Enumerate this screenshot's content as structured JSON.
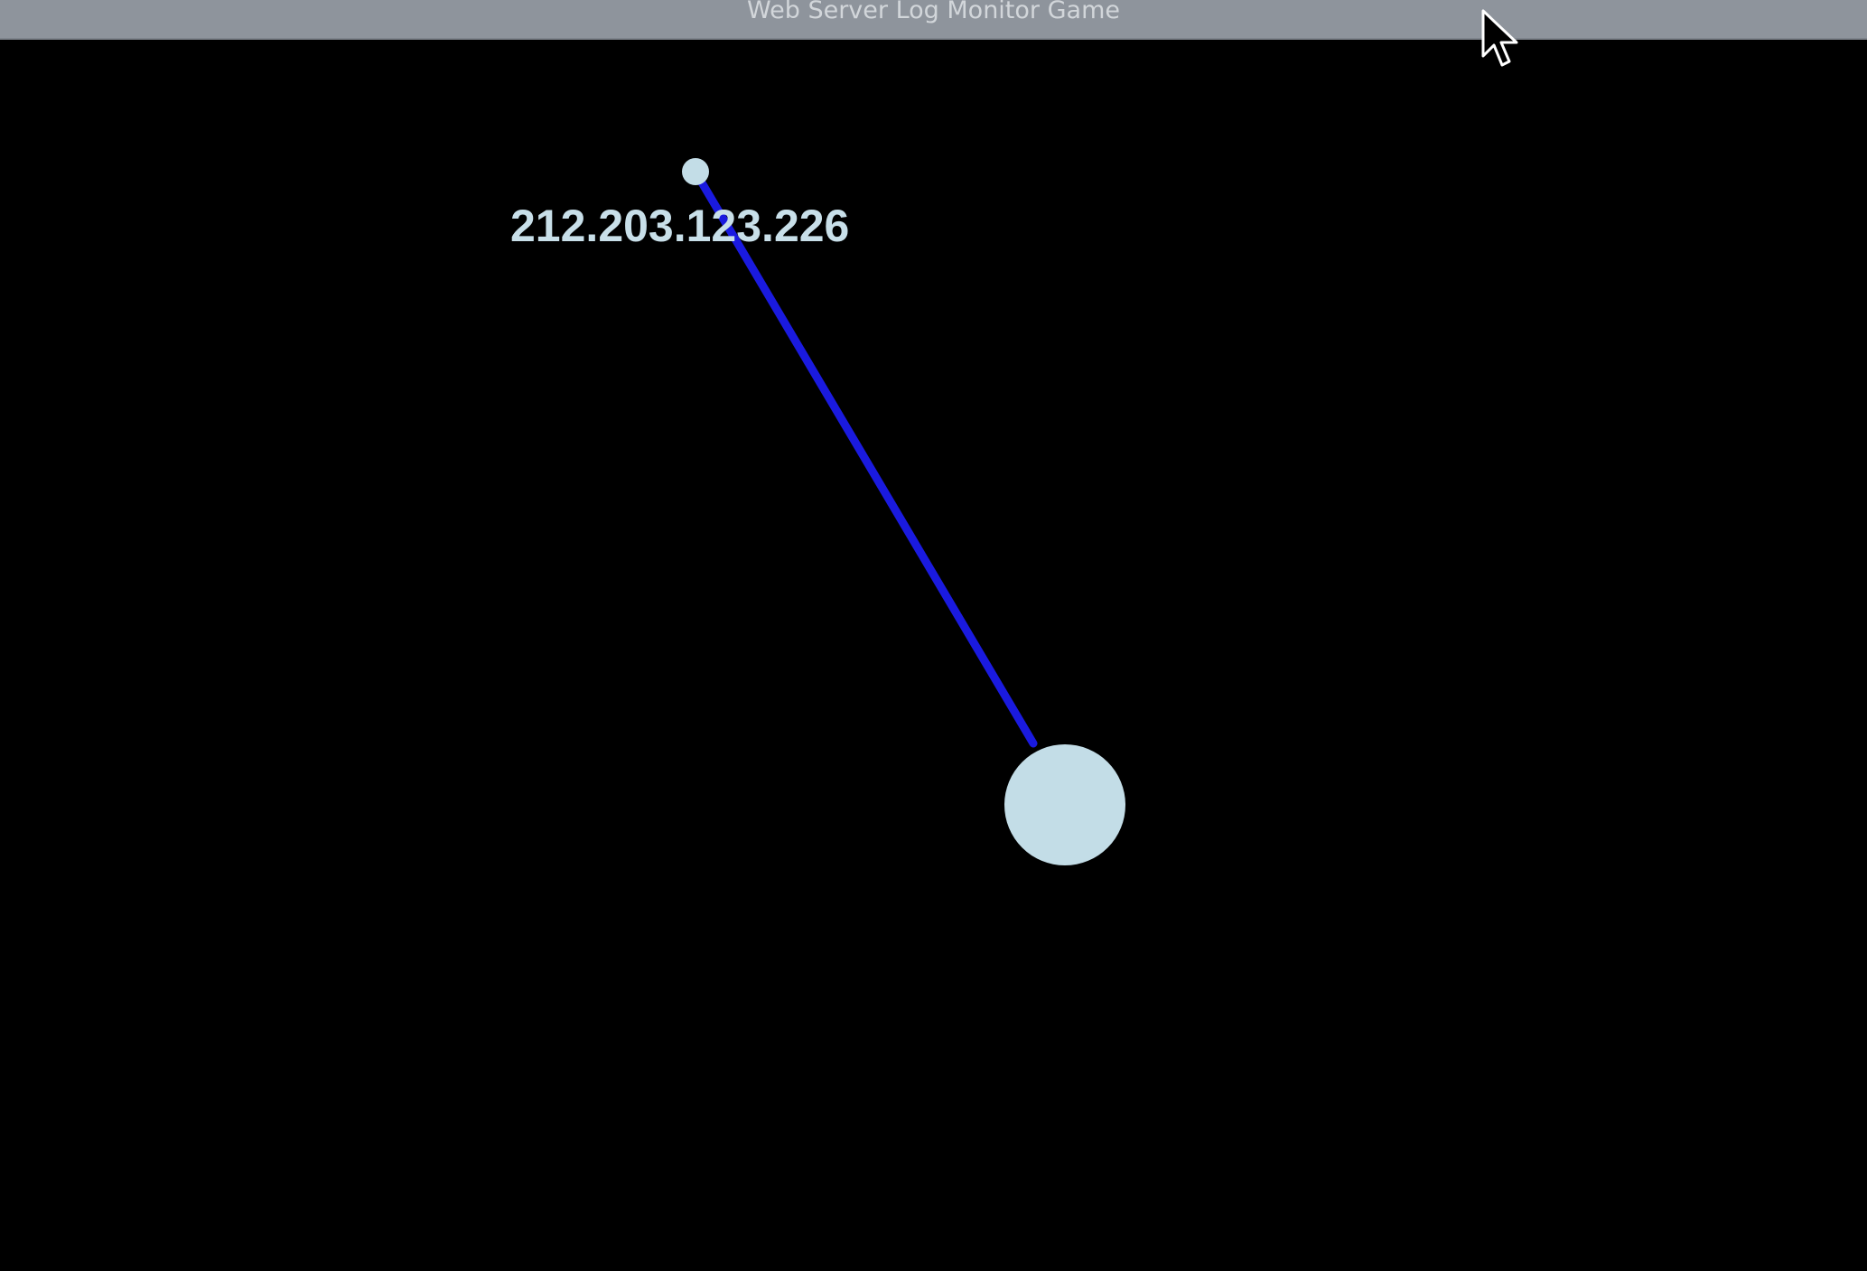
{
  "window": {
    "title": "Web Server Log Monitor Game"
  },
  "scene": {
    "nodes": [
      {
        "type": "client",
        "label": "212.203.123.226"
      },
      {
        "type": "server",
        "label": ""
      }
    ],
    "connection": {
      "from": "212.203.123.226",
      "to": "server"
    }
  },
  "colors": {
    "background": "#000000",
    "titlebar": "#8e949c",
    "title_text": "#d2d6da",
    "node": "#c3dde7",
    "connection_line": "#1a1adf",
    "label_text": "#c8dfe9"
  },
  "icons": {
    "cursor": "mouse-pointer-icon"
  }
}
